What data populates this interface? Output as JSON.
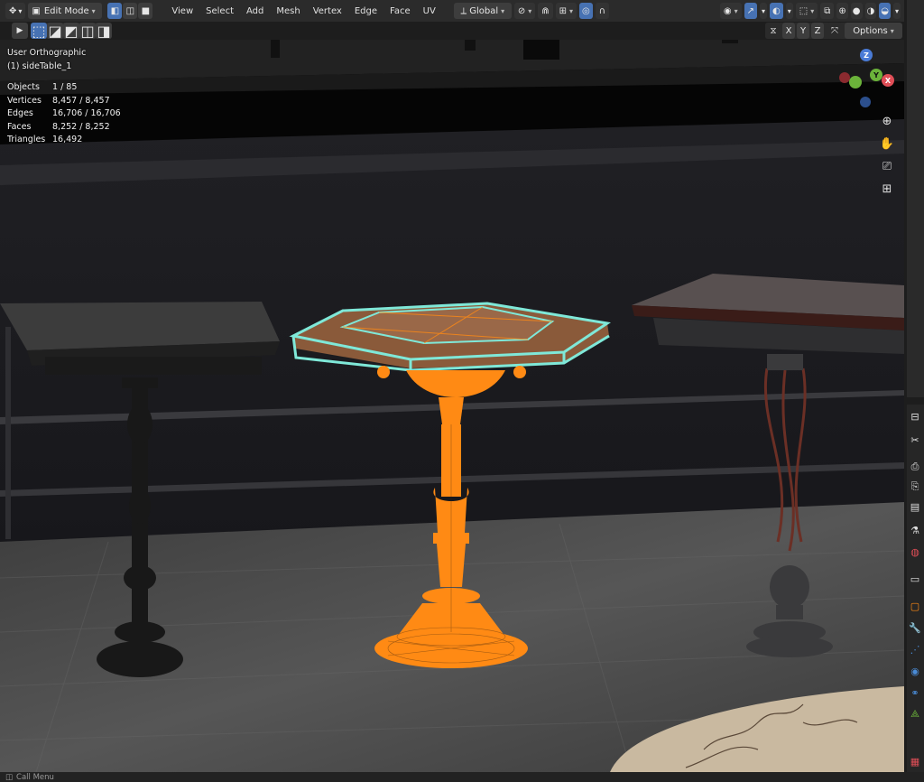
{
  "header": {
    "mode": "Edit Mode",
    "menus": [
      "View",
      "Select",
      "Add",
      "Mesh",
      "Vertex",
      "Edge",
      "Face",
      "UV"
    ],
    "transform_orientation": "Global"
  },
  "subheader": {
    "axes": [
      "X",
      "Y",
      "Z"
    ],
    "options": "Options"
  },
  "viewport": {
    "view_name": "User Orthographic",
    "object_name": "(1) sideTable_1"
  },
  "stats": [
    {
      "label": "Objects",
      "value": "1 / 85"
    },
    {
      "label": "Vertices",
      "value": "8,457 / 8,457"
    },
    {
      "label": "Edges",
      "value": "16,706 / 16,706"
    },
    {
      "label": "Faces",
      "value": "8,252 / 8,252"
    },
    {
      "label": "Triangles",
      "value": "16,492"
    }
  ],
  "gizmo": {
    "z": "Z",
    "y": "Y",
    "x": "X"
  },
  "statusbar": {
    "text": "Call Menu"
  },
  "colors": {
    "selection": "#ff8a14",
    "active_face": "#7fe8d8",
    "header": "#2b2b2b",
    "accent": "#4772b3"
  }
}
